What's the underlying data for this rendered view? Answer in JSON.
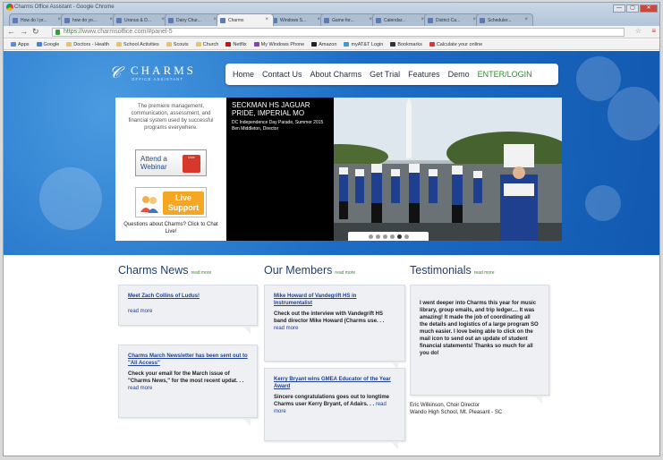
{
  "window": {
    "title": "Charms Office Assistant - Google Chrome",
    "controls": [
      "—",
      "▢",
      "✕"
    ]
  },
  "tabs": [
    {
      "label": "How do I pr..."
    },
    {
      "label": "how do yo..."
    },
    {
      "label": "Uranus & D..."
    },
    {
      "label": "Dairy Chur..."
    },
    {
      "label": "Charms"
    },
    {
      "label": "Windows S..."
    },
    {
      "label": "Game for..."
    },
    {
      "label": "Calendar..."
    },
    {
      "label": "District Ca..."
    },
    {
      "label": "Scheduler..."
    }
  ],
  "address_bar": {
    "https": "https://",
    "url_rest": "www.charmsoffice.com/#panel-5"
  },
  "bookmarks": [
    "Apps",
    "Google",
    "Doctors - Health",
    "School Activities",
    "Scouts",
    "Church",
    "Netflix",
    "My Windows Phone",
    "Amazon",
    "myAT&T Login",
    "Bookmarks",
    "Calculate your online"
  ],
  "site": {
    "logo_name": "CHARMS",
    "logo_sub": "OFFICE ASSISTANT",
    "nav": [
      "Home",
      "Contact Us",
      "About Charms",
      "Get Trial",
      "Features",
      "Demo",
      "ENTER/LOGIN"
    ],
    "tagline": "The premiere management, communication, assessment, and financial system used by successful programs everywhere.",
    "webinar_label": "Attend a Webinar",
    "webinar_icon_label": "Live",
    "support_label": "Live Support",
    "questions": "Questions about Charms? Click to Chat Live!",
    "slide_title": "SECKMAN HS JAGUAR PRIDE, IMPERIAL MO",
    "slide_sub1": "DC Independence Day Parade, Summer 2015",
    "slide_sub2": "Ben Middleton, Director",
    "slide_dot_count": 6,
    "slide_active_dot": 4
  },
  "columns": {
    "news": {
      "title": "Charms News",
      "read_more": "read more",
      "cards": [
        {
          "link": "Meet Zach Collins of Ludus!",
          "body": "",
          "more": "read more"
        },
        {
          "link": "Charms March Newsletter has been sent out to \"All Access\"",
          "body": "Check your email for the March issue of \"Charms News,\" for the most recent updat. . .",
          "more": "read more"
        }
      ]
    },
    "members": {
      "title": "Our Members",
      "read_more": "read more",
      "cards": [
        {
          "link": "Mike Howard of Vandegrift HS in Instrumentalist",
          "body": "Check out the interview with Vandegrift HS band director Mike Howard (Charms use. . .",
          "more": "read more"
        },
        {
          "link": "Kerry Bryant wins GMEA Educator of the Year Award",
          "body": "Sincere congratulations goes out to longtime Charms user Kerry Bryant, of Adairs. . .",
          "more": "read more"
        }
      ]
    },
    "testimonials": {
      "title": "Testimonials",
      "read_more": "read more",
      "quote": "I went deeper into Charms this year for music library, group emails, and trip ledger.... It was amazing! It made the job of coordinating all the details and logistics of a large program SO much easier. I love being able to click on the mail icon to send out an update of student financial statements! Thanks so much for all you do!",
      "author1": "Eric Wilkinson, Choir Director",
      "author2": "Wando High School, Mt. Pleasant - SC"
    }
  }
}
